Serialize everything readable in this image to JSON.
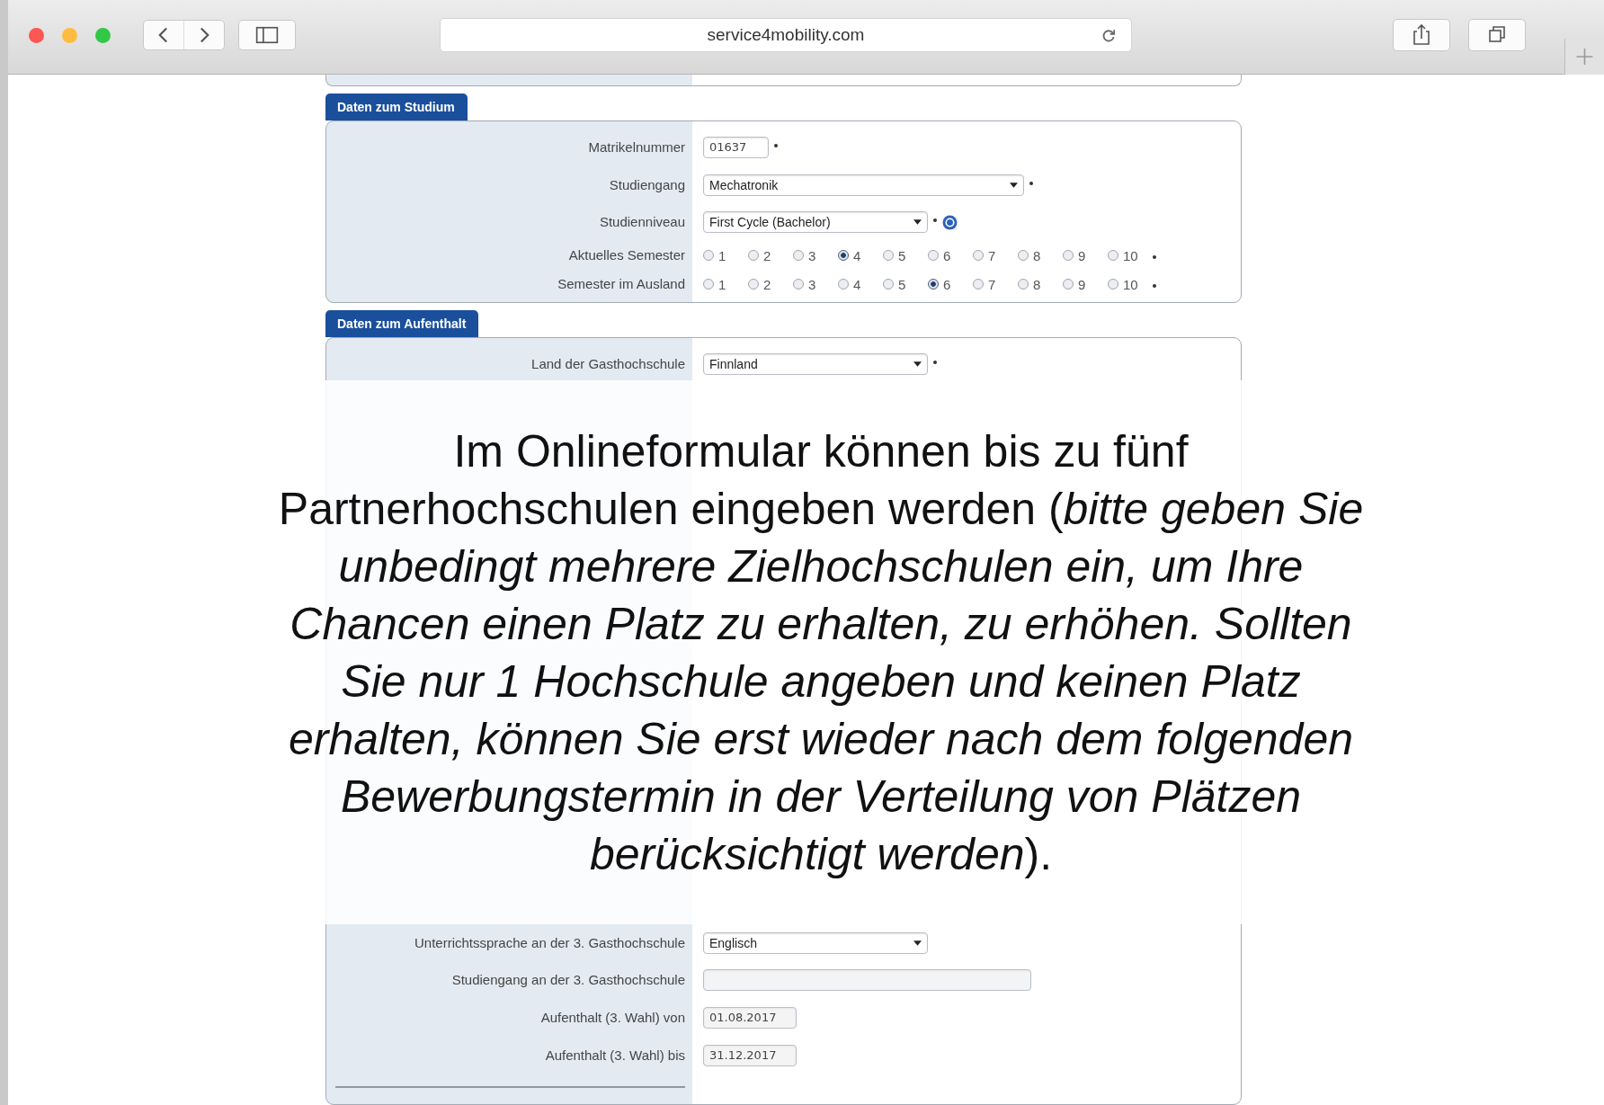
{
  "browser": {
    "url": "service4mobility.com"
  },
  "sections": [
    {
      "title": "Daten zum Studium",
      "rows": [
        {
          "kind": "shortfield",
          "label": "Matrikelnummer",
          "value": "01637",
          "required": true
        },
        {
          "kind": "longselect",
          "label": "Studiengang",
          "value": "Mechatronik",
          "required": true
        },
        {
          "kind": "select",
          "label": "Studienniveau",
          "value": "First Cycle (Bachelor)",
          "required": true,
          "help": true
        },
        {
          "kind": "radio",
          "label": "Aktuelles Semester",
          "required": true,
          "options": [
            {
              "label": "1",
              "selected": false
            },
            {
              "label": "2",
              "selected": false
            },
            {
              "label": "3",
              "selected": false
            },
            {
              "label": "4",
              "selected": true
            },
            {
              "label": "5",
              "selected": false
            },
            {
              "label": "6",
              "selected": false
            },
            {
              "label": "7",
              "selected": false
            },
            {
              "label": "8",
              "selected": false
            },
            {
              "label": "9",
              "selected": false
            },
            {
              "label": "10",
              "selected": false
            }
          ]
        },
        {
          "kind": "radio",
          "label": "Semester im Ausland",
          "required": true,
          "options": [
            {
              "label": "1",
              "selected": false
            },
            {
              "label": "2",
              "selected": false
            },
            {
              "label": "3",
              "selected": false
            },
            {
              "label": "4",
              "selected": false
            },
            {
              "label": "5",
              "selected": false
            },
            {
              "label": "6",
              "selected": true
            },
            {
              "label": "7",
              "selected": false
            },
            {
              "label": "8",
              "selected": false
            },
            {
              "label": "9",
              "selected": false
            },
            {
              "label": "10",
              "selected": false
            }
          ]
        }
      ]
    },
    {
      "title": "Daten zum Aufenthalt",
      "rows": [
        {
          "kind": "select",
          "label": "Land der Gasthochschule",
          "value": "Finnland",
          "required": true
        },
        {
          "kind": "covered"
        },
        {
          "kind": "covered"
        },
        {
          "kind": "covered"
        },
        {
          "kind": "covered"
        },
        {
          "kind": "covered"
        },
        {
          "kind": "coveredgap"
        },
        {
          "kind": "covered"
        },
        {
          "kind": "covered"
        },
        {
          "kind": "covered"
        },
        {
          "kind": "covered"
        },
        {
          "kind": "covered"
        },
        {
          "kind": "covered"
        },
        {
          "kind": "coveredgap"
        },
        {
          "kind": "covered"
        },
        {
          "kind": "covered"
        },
        {
          "kind": "select",
          "label": "Unterrichtssprache an der 3. Gasthochschule",
          "value": "Englisch"
        },
        {
          "kind": "textfield",
          "label": "Studiengang an der 3. Gasthochschule"
        },
        {
          "kind": "datefield",
          "label": "Aufenthalt (3. Wahl) von",
          "value": "01.08.2017"
        },
        {
          "kind": "datefield",
          "label": "Aufenthalt (3. Wahl) bis",
          "value": "31.12.2017"
        },
        {
          "kind": "divider"
        }
      ]
    }
  ],
  "overlay": {
    "text": "Im Onlineformular können bis zu fünf Partnerhochschulen eingeben werden (*bitte geben Sie unbedingt mehrere Zielhochschulen ein, um Ihre Chancen einen Platz zu erhalten, zu erhöhen. Sollten Sie nur 1 Hochschule angeben und keinen Platz erhalten, können Sie erst wieder nach dem folgenden Bewerbungstermin in der Verteilung von Plätzen berücksichtigt werden*)."
  }
}
